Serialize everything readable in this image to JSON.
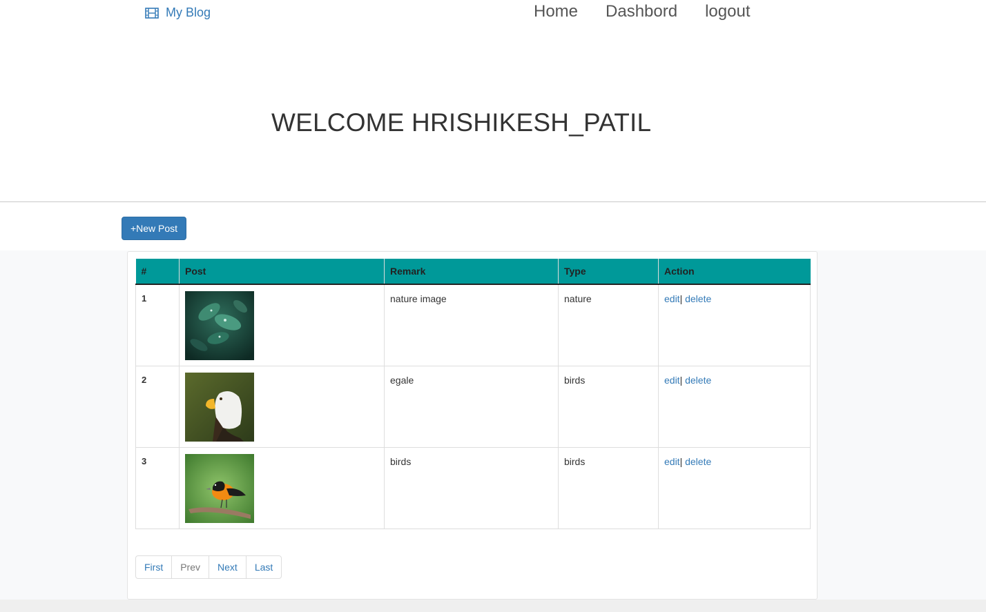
{
  "navbar": {
    "brand": "My Blog",
    "brand_icon": "film-icon",
    "links": [
      "Home",
      "Dashbord",
      "logout"
    ]
  },
  "hero": {
    "welcome": "WELCOME HRISHIKESH_PATIL"
  },
  "actions": {
    "new_post": "+New Post"
  },
  "table": {
    "headers": [
      "#",
      "Post",
      "Remark",
      "Type",
      "Action"
    ],
    "rows": [
      {
        "num": "1",
        "image": "leaves-photo",
        "remark": "nature image",
        "type": "nature",
        "edit": "edit",
        "sep": "|",
        "delete": "delete"
      },
      {
        "num": "2",
        "image": "eagle-photo",
        "remark": "egale",
        "type": "birds",
        "edit": "edit",
        "sep": "|",
        "delete": "delete"
      },
      {
        "num": "3",
        "image": "oriole-photo",
        "remark": "birds",
        "type": "birds",
        "edit": "edit",
        "sep": "|",
        "delete": "delete"
      }
    ]
  },
  "pagination": [
    "First",
    "Prev",
    "Next",
    "Last"
  ],
  "colors": {
    "accent": "#337ab7",
    "table_header": "#009999"
  }
}
